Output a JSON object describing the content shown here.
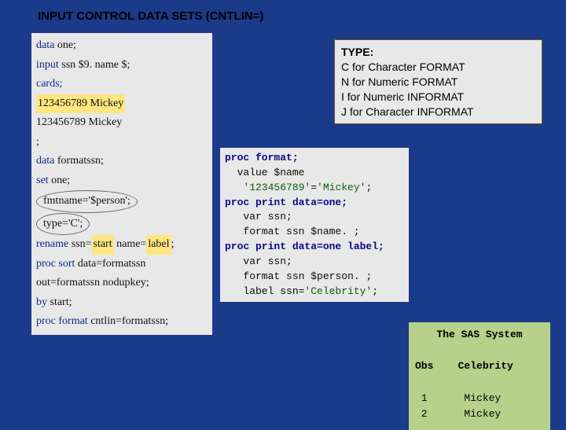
{
  "title": "INPUT CONTROL DATA SETS (CNTLIN=)",
  "type_box": {
    "heading": "TYPE:",
    "lines": [
      "C for Character FORMAT",
      "N for Numeric FORMAT",
      "I for Numeric INFORMAT",
      "J for Character INFORMAT"
    ]
  },
  "code_left": {
    "l1a": "data",
    "l1b": " one;",
    "l2a": "input",
    "l2b": " ssn $9. name $;",
    "l3": "cards;",
    "l4": "123456789 Mickey",
    "l5": "123456789 Mickey",
    "l6": ";",
    "l7a": "data",
    "l7b": " formatssn;",
    "l8a": "set",
    "l8b": " one;",
    "l9": "fmtname='$person';",
    "l10": "type='C';",
    "l11a": "rename",
    "l11b_a": " ssn=",
    "l11b_b": "start",
    "l11b_c": " name=",
    "l11b_d": "label",
    "l11b_e": ";",
    "l12a": "proc sort",
    "l12b": " data=formatssn",
    "l13": "out=formatssn nodupkey;",
    "l14a": "by",
    "l14b": " start;",
    "l15a": "proc format",
    "l15b": " cntlin=formatssn;"
  },
  "code_mid": {
    "l1": "proc format;",
    "l2a": "  value ",
    "l2b": "$name",
    "l3a": "   ",
    "l3b": "'123456789'",
    "l3c": "=",
    "l3d": "'Mickey'",
    "l3e": ";",
    "l4": "proc print data=one;",
    "l5": "   var ssn;",
    "l6a": "   format ssn ",
    "l6b": "$name.",
    "l6c": " ;",
    "l7": "proc print data=one label;",
    "l8": "   var ssn;",
    "l9a": "   format ssn ",
    "l9b": "$person.",
    "l9c": " ;",
    "l10a": "   label ssn=",
    "l10b": "'Celebrity'",
    "l10c": ";"
  },
  "output": {
    "title": "The SAS System",
    "header": "Obs    Celebrity",
    "rows": [
      " 1      Mickey",
      " 2      Mickey"
    ]
  }
}
